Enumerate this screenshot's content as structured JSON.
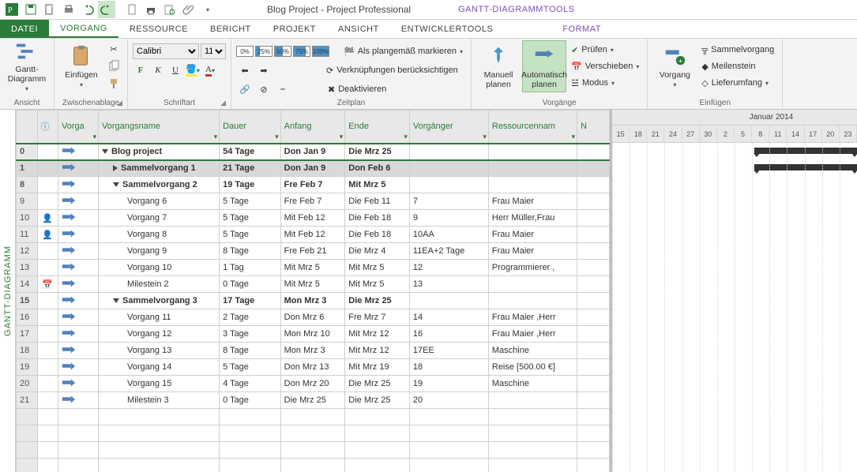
{
  "title": "Blog Project - Project Professional",
  "context_tools": "GANTT-DIAGRAMMTOOLS",
  "tabs": {
    "file": "DATEI",
    "vorgang": "VORGANG",
    "ressource": "RESSOURCE",
    "bericht": "BERICHT",
    "projekt": "PROJEKT",
    "ansicht": "ANSICHT",
    "dev": "ENTWICKLERTOOLS",
    "format": "FORMAT"
  },
  "ribbon": {
    "ansicht": {
      "gantt": "Gantt-\nDiagramm",
      "label": "Ansicht"
    },
    "clipboard": {
      "paste": "Einfügen",
      "label": "Zwischenablage"
    },
    "font": {
      "name": "Calibri",
      "size": "11",
      "bold": "F",
      "italic": "K",
      "underline": "U",
      "label": "Schriftart"
    },
    "schedule": {
      "asplanned": "Als plangemäß markieren",
      "links": "Verknüpfungen berücksichtigen",
      "deactivate": "Deaktivieren",
      "label": "Zeitplan",
      "p0": "0%",
      "p25": "25%",
      "p50": "50%",
      "p75": "75%",
      "p100": "100%"
    },
    "tasks": {
      "manual": "Manuell\nplanen",
      "auto": "Automatisch\nplanen",
      "inspect": "Prüfen",
      "move": "Verschieben",
      "mode": "Modus",
      "label": "Vorgänge"
    },
    "insert": {
      "task": "Vorgang",
      "summary": "Sammelvorgang",
      "milestone": "Meilenstein",
      "deliverable": "Lieferumfang",
      "label": "Einfügen"
    }
  },
  "columns": {
    "ind": "ⓘ",
    "mode": "Vorga",
    "name": "Vorgangsname",
    "dur": "Dauer",
    "start": "Anfang",
    "end": "Ende",
    "pre": "Vorgänger",
    "res": "Ressourcennam",
    "add": "N"
  },
  "timeline": {
    "month": "Januar 2014",
    "days": [
      "15",
      "18",
      "21",
      "24",
      "27",
      "30",
      "2",
      "5",
      "8",
      "11",
      "14",
      "17",
      "20",
      "23"
    ]
  },
  "sidebar": "GANTT-DIAGRAMM",
  "rows": [
    {
      "n": "0",
      "lvl": 0,
      "summary": true,
      "project": true,
      "open": true,
      "name": "Blog project",
      "dur": "54 Tage",
      "start": "Don Jan 9",
      "end": "Die Mrz 25",
      "pre": "",
      "res": ""
    },
    {
      "n": "1",
      "lvl": 1,
      "summary": true,
      "selected": true,
      "closed": true,
      "name": "Sammelvorgang 1",
      "dur": "21 Tage",
      "start": "Don Jan 9",
      "end": "Don Feb 6",
      "pre": "",
      "res": ""
    },
    {
      "n": "8",
      "lvl": 1,
      "summary": true,
      "open": true,
      "name": "Sammelvorgang 2",
      "dur": "19 Tage",
      "start": "Fre Feb 7",
      "end": "Mit Mrz 5",
      "pre": "",
      "res": ""
    },
    {
      "n": "9",
      "lvl": 2,
      "name": "Vorgang 6",
      "dur": "5 Tage",
      "start": "Fre Feb 7",
      "end": "Die Feb 11",
      "pre": "7",
      "res": "Frau Maier"
    },
    {
      "n": "10",
      "lvl": 2,
      "ind": "person",
      "name": "Vorgang 7",
      "dur": "5 Tage",
      "start": "Mit Feb 12",
      "end": "Die Feb 18",
      "pre": "9",
      "res": "Herr Müller,Frau"
    },
    {
      "n": "11",
      "lvl": 2,
      "ind": "person",
      "name": "Vorgang 8",
      "dur": "5 Tage",
      "start": "Mit Feb 12",
      "end": "Die Feb 18",
      "pre": "10AA",
      "res": "Frau Maier"
    },
    {
      "n": "12",
      "lvl": 2,
      "name": "Vorgang 9",
      "dur": "8 Tage",
      "start": "Fre Feb 21",
      "end": "Die Mrz 4",
      "pre": "11EA+2 Tage",
      "res": "Frau Maier"
    },
    {
      "n": "13",
      "lvl": 2,
      "name": "Vorgang 10",
      "dur": "1 Tag",
      "start": "Mit Mrz 5",
      "end": "Mit Mrz 5",
      "pre": "12",
      "res": "Programmierer ,"
    },
    {
      "n": "14",
      "lvl": 2,
      "ind": "cal",
      "name": "Milestein 2",
      "dur": "0 Tage",
      "start": "Mit Mrz 5",
      "end": "Mit Mrz 5",
      "pre": "13",
      "res": ""
    },
    {
      "n": "15",
      "lvl": 1,
      "summary": true,
      "open": true,
      "name": "Sammelvorgang 3",
      "dur": "17 Tage",
      "start": "Mon Mrz 3",
      "end": "Die Mrz 25",
      "pre": "",
      "res": ""
    },
    {
      "n": "16",
      "lvl": 2,
      "name": "Vorgang 11",
      "dur": "2 Tage",
      "start": "Don Mrz 6",
      "end": "Fre Mrz 7",
      "pre": "14",
      "res": "Frau Maier ,Herr"
    },
    {
      "n": "17",
      "lvl": 2,
      "name": "Vorgang 12",
      "dur": "3 Tage",
      "start": "Mon Mrz 10",
      "end": "Mit Mrz 12",
      "pre": "16",
      "res": "Frau Maier ,Herr"
    },
    {
      "n": "18",
      "lvl": 2,
      "name": "Vorgang 13",
      "dur": "8 Tage",
      "start": "Mon Mrz 3",
      "end": "Mit Mrz 12",
      "pre": "17EE",
      "res": "Maschine"
    },
    {
      "n": "19",
      "lvl": 2,
      "name": "Vorgang 14",
      "dur": "5 Tage",
      "start": "Don Mrz 13",
      "end": "Mit Mrz 19",
      "pre": "18",
      "res": "Reise [500.00 €]"
    },
    {
      "n": "20",
      "lvl": 2,
      "name": "Vorgang 15",
      "dur": "4 Tage",
      "start": "Don Mrz 20",
      "end": "Die Mrz 25",
      "pre": "19",
      "res": "Maschine"
    },
    {
      "n": "21",
      "lvl": 2,
      "name": "Milestein 3",
      "dur": "0 Tage",
      "start": "Die Mrz 25",
      "end": "Die Mrz 25",
      "pre": "20",
      "res": ""
    }
  ]
}
